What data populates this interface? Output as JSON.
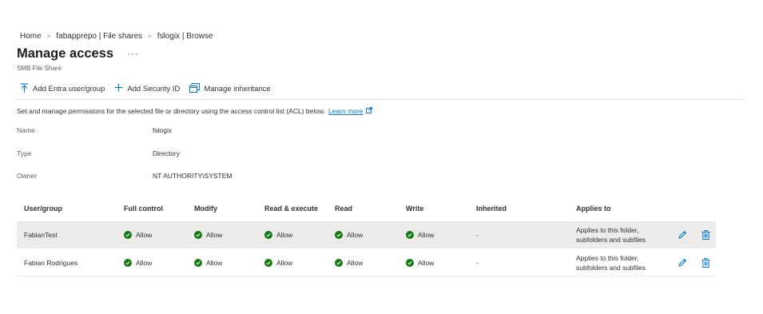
{
  "breadcrumb": {
    "home": "Home",
    "share": "fabapprepo | File shares",
    "browse": "fslogix | Browse",
    "sep": ">"
  },
  "header": {
    "title": "Manage access",
    "more": "···",
    "subtitle": "SMB File Share"
  },
  "toolbar": {
    "add_entra": "Add Entra user/group",
    "add_sid": "Add Security ID",
    "manage_inheritance": "Manage inheritance"
  },
  "description": {
    "text": "Set and manage permissions for the selected file or directory using the access control list (ACL) below.",
    "learn_more": "Learn more"
  },
  "properties": {
    "name_label": "Name",
    "name_value": "fslogix",
    "type_label": "Type",
    "type_value": "Directory",
    "owner_label": "Owner",
    "owner_value": "NT AUTHORITY\\SYSTEM"
  },
  "table": {
    "headers": {
      "user": "User/group",
      "full": "Full control",
      "modify": "Modify",
      "readexec": "Read & execute",
      "read": "Read",
      "write": "Write",
      "inherited": "Inherited",
      "applies": "Applies to"
    },
    "rows": [
      {
        "user": "FabianTest",
        "full": "Allow",
        "modify": "Allow",
        "readexec": "Allow",
        "read": "Allow",
        "write": "Allow",
        "inherited": "-",
        "applies_line1": "Applies to this folder,",
        "applies_line2": "subfolders and subfiles"
      },
      {
        "user": "Fabian Rodrigues",
        "full": "Allow",
        "modify": "Allow",
        "readexec": "Allow",
        "read": "Allow",
        "write": "Allow",
        "inherited": "-",
        "applies_line1": "Applies to this folder,",
        "applies_line2": "subfolders and subfiles"
      }
    ]
  },
  "colors": {
    "accent": "#0078d4",
    "allow": "#107c10",
    "selected_row": "#edebe9"
  }
}
